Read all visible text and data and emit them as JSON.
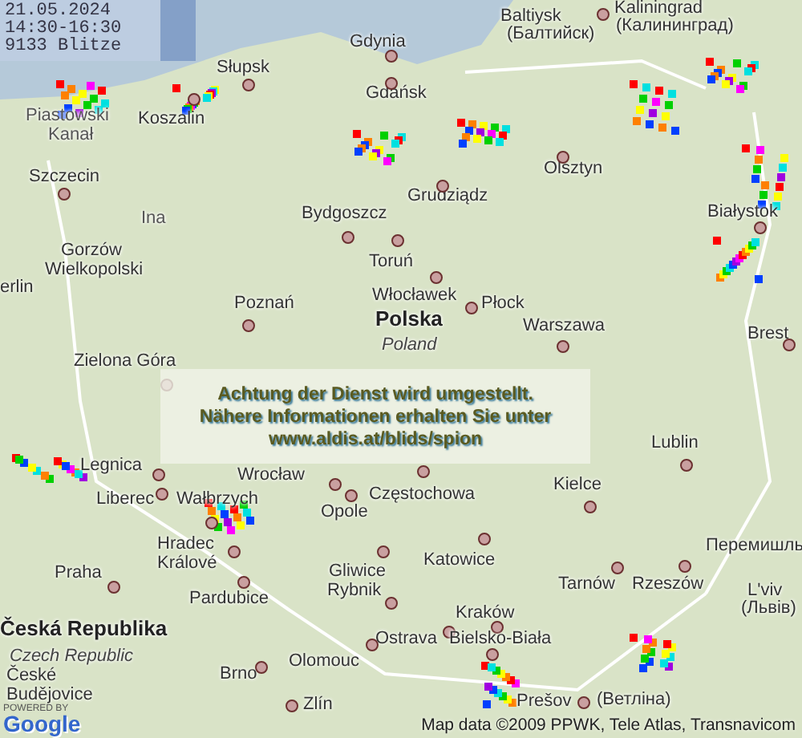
{
  "header": {
    "date": "21.05.2024",
    "time_range": "14:30-16:30",
    "strike_count": "9133 Blitze"
  },
  "map": {
    "labels": [
      {
        "text": "Baltiysk",
        "kind": "town"
      },
      {
        "text": "(Балтийск)",
        "kind": "town"
      },
      {
        "text": "Kaliningrad",
        "kind": "city"
      },
      {
        "text": "(Калининград)",
        "kind": "town"
      },
      {
        "text": "Gdynia",
        "kind": "city"
      },
      {
        "text": "Słupsk",
        "kind": "city"
      },
      {
        "text": "Koszalin",
        "kind": "city"
      },
      {
        "text": "Gdańsk",
        "kind": "city"
      },
      {
        "text": "Piastowski",
        "kind": "region"
      },
      {
        "text": "Kanał",
        "kind": "region"
      },
      {
        "text": "Olsztyn",
        "kind": "city"
      },
      {
        "text": "Grudziądz",
        "kind": "city"
      },
      {
        "text": "Szczecin",
        "kind": "city"
      },
      {
        "text": "Ina",
        "kind": "region"
      },
      {
        "text": "Bydgoszcz",
        "kind": "city"
      },
      {
        "text": "Białystok",
        "kind": "city"
      },
      {
        "text": "Gorzów",
        "kind": "town"
      },
      {
        "text": "Wielkopolski",
        "kind": "city"
      },
      {
        "text": "Toruń",
        "kind": "city"
      },
      {
        "text": "erlin",
        "kind": "town"
      },
      {
        "text": "Poznań",
        "kind": "city"
      },
      {
        "text": "Włocławek",
        "kind": "city"
      },
      {
        "text": "Płock",
        "kind": "city"
      },
      {
        "text": "Polska",
        "kind": "country"
      },
      {
        "text": "Poland",
        "kind": "country_en"
      },
      {
        "text": "Warszawa",
        "kind": "city"
      },
      {
        "text": "Brest",
        "kind": "city"
      },
      {
        "text": "Zielona Góra",
        "kind": "city"
      },
      {
        "text": "Lublin",
        "kind": "city"
      },
      {
        "text": "Legnica",
        "kind": "city"
      },
      {
        "text": "Wrocław",
        "kind": "city"
      },
      {
        "text": "Liberec",
        "kind": "city"
      },
      {
        "text": "Wałbrzych",
        "kind": "city"
      },
      {
        "text": "Opole",
        "kind": "city"
      },
      {
        "text": "Częstochowa",
        "kind": "city"
      },
      {
        "text": "Kielce",
        "kind": "city"
      },
      {
        "text": "Hradec",
        "kind": "town"
      },
      {
        "text": "Králové",
        "kind": "city"
      },
      {
        "text": "Praha",
        "kind": "city"
      },
      {
        "text": "Pardubice",
        "kind": "city"
      },
      {
        "text": "Gliwice",
        "kind": "city"
      },
      {
        "text": "Katowice",
        "kind": "city"
      },
      {
        "text": "Rybnik",
        "kind": "city"
      },
      {
        "text": "Tarnów",
        "kind": "city"
      },
      {
        "text": "Rzeszów",
        "kind": "city"
      },
      {
        "text": "Kraków",
        "kind": "city"
      },
      {
        "text": "Česká Republika",
        "kind": "country"
      },
      {
        "text": "Czech Republic",
        "kind": "country_en"
      },
      {
        "text": "Ostrava",
        "kind": "city"
      },
      {
        "text": "Bielsko-Biała",
        "kind": "city"
      },
      {
        "text": "Olomouc",
        "kind": "city"
      },
      {
        "text": "Brno",
        "kind": "city"
      },
      {
        "text": "Zlín",
        "kind": "city"
      },
      {
        "text": "Prešov",
        "kind": "city"
      },
      {
        "text": "(Ветліна)",
        "kind": "town"
      },
      {
        "text": "Перемишль",
        "kind": "town"
      },
      {
        "text": "L'viv",
        "kind": "city"
      },
      {
        "text": "(Львів)",
        "kind": "town"
      },
      {
        "text": "České",
        "kind": "town"
      },
      {
        "text": "Budějovice",
        "kind": "city"
      }
    ]
  },
  "notice": {
    "lines": [
      "Achtung der Dienst wird umgestellt.",
      "Nähere Informationen erhalten Sie unter",
      "www.aldis.at/blids/spion"
    ]
  },
  "logo": {
    "caption": "POWERED BY",
    "name": "Google"
  },
  "attribution": "Map data ©2009 PPWK, Tele Atlas, Transnavicom"
}
